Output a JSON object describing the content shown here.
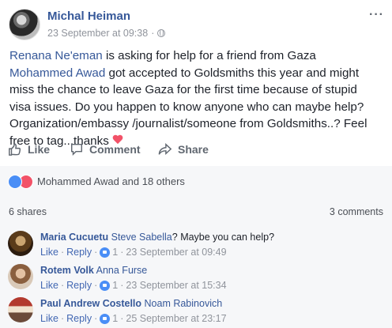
{
  "post": {
    "author": "Michal Heiman",
    "timestamp": "23 September at 09:38",
    "separator": "·",
    "more_label": "···",
    "text": {
      "tag1": "Renana Ne'eman",
      "part1": " is asking for help for a friend from Gaza ",
      "tag2": "Mohammed Awad",
      "part2": " got accepted to Goldsmiths this year and might miss the chance to leave Gaza for the first time because of stupid visa issues. Do you happen to know anyone who can maybe help? Organization/embassy /journalist/someone from Goldsmiths..? Feel free to tag...thanks "
    }
  },
  "actions": {
    "like": "Like",
    "comment": "Comment",
    "share": "Share"
  },
  "reactions": {
    "summary": "Mohammed Awad and 18 others"
  },
  "stats": {
    "shares": "6 shares",
    "comments": "3 comments"
  },
  "comments": [
    {
      "name": "Maria Cucuetu",
      "tag": "Steve Sabella",
      "text": "? Maybe you can help?",
      "like": "Like",
      "reply": "Reply",
      "likes": "1",
      "time": "23 September at 09:49"
    },
    {
      "name": "Rotem Volk",
      "tag": "Anna Furse",
      "text": "",
      "like": "Like",
      "reply": "Reply",
      "likes": "1",
      "time": "23 September at 15:34"
    },
    {
      "name": "Paul Andrew Costello",
      "tag": "Noam Rabinovich",
      "text": "",
      "like": "Like",
      "reply": "Reply",
      "likes": "1",
      "time": "25 September at 23:17"
    }
  ],
  "colors": {
    "link": "#365899",
    "muted": "#90949c",
    "like_blue": "#4a8ef6",
    "love_red": "#f25268"
  }
}
